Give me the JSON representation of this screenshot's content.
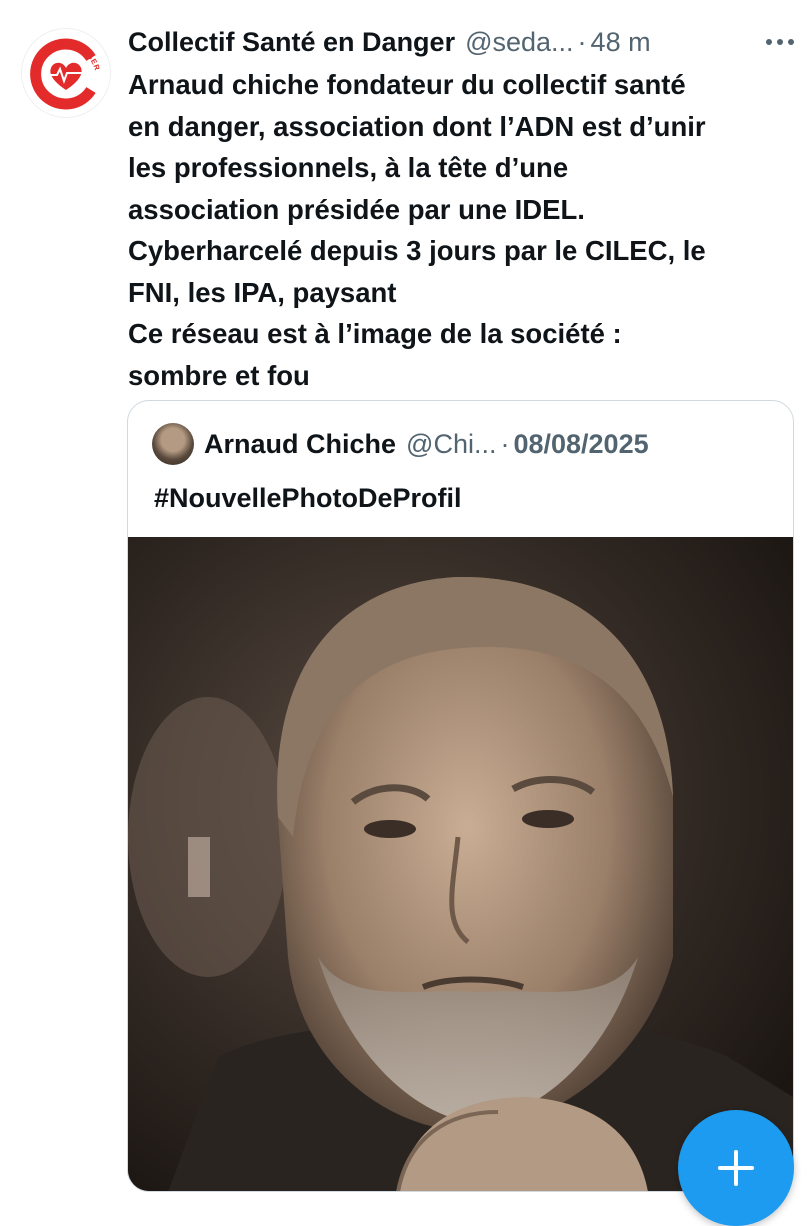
{
  "tweet": {
    "author_name": "Collectif Santé en Danger",
    "author_handle": "@seda...",
    "separator": "·",
    "time": "48 m",
    "avatar_logo_text": "SANTÉ EN DANGER",
    "text_lines": [
      "Arnaud chiche fondateur du collectif santé",
      "en danger, association dont l’ADN est d’unir",
      "les professionnels, à la tête d’une",
      "association présidée par une IDEL.",
      "Cyberharcelé depuis 3 jours par le CILEC, le",
      "FNI, les IPA, paysant",
      "Ce réseau est à l’image de la société :",
      "sombre et fou"
    ],
    "more_icon": "more-dots-icon"
  },
  "quote": {
    "author_name": "Arnaud Chiche",
    "author_handle": "@Chi...",
    "separator": "·",
    "date": "08/08/2025",
    "text": "#NouvellePhotoDeProfil",
    "photo": "profile-photo-sepia-portrait"
  },
  "fab": {
    "icon": "plus-icon"
  },
  "colors": {
    "text": "#0f1419",
    "secondary": "#536471",
    "border": "#cfd9de",
    "accent": "#1d9bf0",
    "logo_red": "#e32b2b"
  }
}
